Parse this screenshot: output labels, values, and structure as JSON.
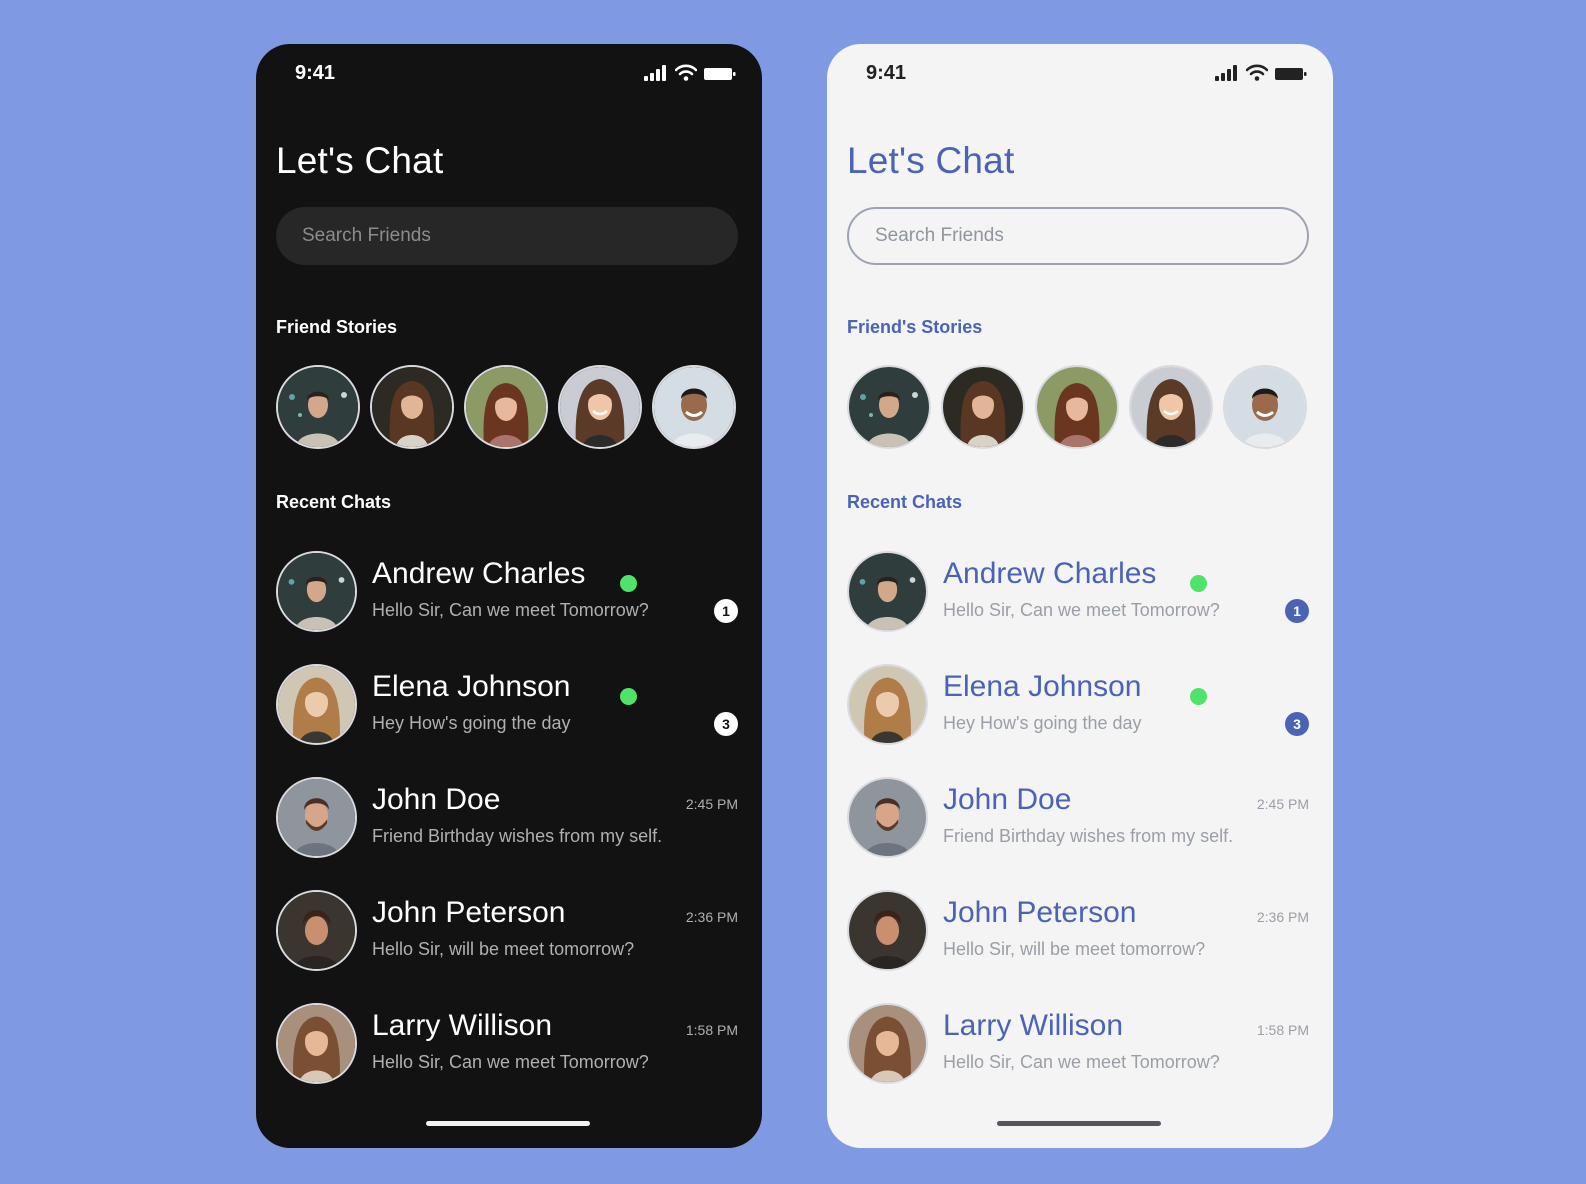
{
  "colors": {
    "page_background": "#7f9ae2",
    "dark_background": "#121212",
    "light_background": "#f4f4f4",
    "accent_blue": "#4a63b5",
    "online_green": "#4fe36a"
  },
  "screens": [
    {
      "theme": "dark",
      "status_time": "9:41",
      "title": "Let's Chat",
      "search_placeholder": "Search Friends",
      "stories_label": "Friend Stories",
      "recent_label": "Recent Chats",
      "stories": [
        {
          "icon": "man-dark-hair-avatar"
        },
        {
          "icon": "woman-long-brown-hair-avatar"
        },
        {
          "icon": "woman-auburn-hair-avatar"
        },
        {
          "icon": "woman-smiling-avatar"
        },
        {
          "icon": "man-smiling-avatar"
        }
      ],
      "chats": [
        {
          "name": "Andrew Charles",
          "message": "Hello Sir, Can we meet Tomorrow?",
          "online": true,
          "unread": "1",
          "time": ""
        },
        {
          "name": "Elena Johnson",
          "message": "Hey How's going the day",
          "online": true,
          "unread": "3",
          "time": ""
        },
        {
          "name": "John Doe",
          "message": "Friend Birthday wishes from my self.",
          "online": false,
          "unread": "",
          "time": "2:45 PM"
        },
        {
          "name": "John Peterson",
          "message": "Hello Sir, will be meet tomorrow?",
          "online": false,
          "unread": "",
          "time": "2:36 PM"
        },
        {
          "name": "Larry Willison",
          "message": "Hello Sir, Can we meet Tomorrow?",
          "online": false,
          "unread": "",
          "time": "1:58 PM"
        }
      ]
    },
    {
      "theme": "light",
      "status_time": "9:41",
      "title": "Let's Chat",
      "search_placeholder": "Search Friends",
      "stories_label": "Friend's Stories",
      "recent_label": "Recent Chats",
      "stories": [
        {
          "icon": "man-dark-hair-avatar"
        },
        {
          "icon": "woman-long-brown-hair-avatar"
        },
        {
          "icon": "woman-auburn-hair-avatar"
        },
        {
          "icon": "woman-smiling-avatar"
        },
        {
          "icon": "man-smiling-avatar"
        }
      ],
      "chats": [
        {
          "name": "Andrew Charles",
          "message": "Hello Sir, Can we meet Tomorrow?",
          "online": true,
          "unread": "1",
          "time": ""
        },
        {
          "name": "Elena Johnson",
          "message": "Hey How's going the day",
          "online": true,
          "unread": "3",
          "time": ""
        },
        {
          "name": "John Doe",
          "message": "Friend Birthday wishes from my self.",
          "online": false,
          "unread": "",
          "time": "2:45 PM"
        },
        {
          "name": "John Peterson",
          "message": "Hello Sir, will be meet tomorrow?",
          "online": false,
          "unread": "",
          "time": "2:36 PM"
        },
        {
          "name": "Larry Willison",
          "message": "Hello Sir, Can we meet Tomorrow?",
          "online": false,
          "unread": "",
          "time": "1:58 PM"
        }
      ]
    }
  ]
}
